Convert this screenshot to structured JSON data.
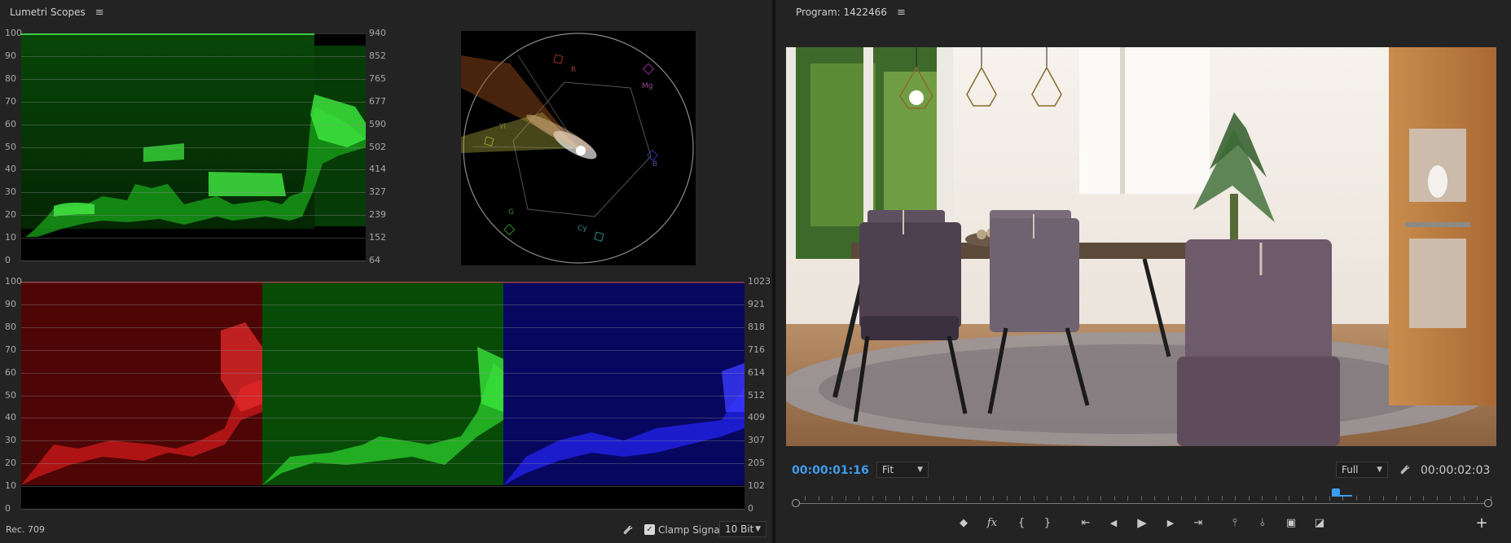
{
  "scopes": {
    "title": "Lumetri Scopes",
    "menu_icon": "hamburger-menu-icon",
    "luma_left_ticks": [
      "100",
      "90",
      "80",
      "70",
      "60",
      "50",
      "40",
      "30",
      "20",
      "10",
      "0"
    ],
    "luma_right_ticks": [
      "940",
      "852",
      "765",
      "677",
      "590",
      "502",
      "414",
      "327",
      "239",
      "152",
      "64"
    ],
    "rgb_left_ticks": [
      "100",
      "90",
      "80",
      "70",
      "60",
      "50",
      "40",
      "30",
      "20",
      "10",
      "0"
    ],
    "rgb_right_ticks": [
      "1023",
      "921",
      "818",
      "716",
      "614",
      "512",
      "409",
      "307",
      "205",
      "102",
      "0"
    ],
    "vectorscope_labels": {
      "r": "R",
      "mg": "Mg",
      "b": "B",
      "cy": "Cy",
      "g": "G",
      "yl": "Yl"
    },
    "footer": {
      "color_space": "Rec. 709",
      "clamp_label": "Clamp Signal",
      "clamp_checked": true,
      "bit_depth": "10 Bit"
    }
  },
  "program": {
    "title": "Program: 1422466",
    "menu_icon": "hamburger-menu-icon",
    "timecode_current": "00:00:01:16",
    "zoom": "Fit",
    "resolution": "Full",
    "timecode_duration": "00:00:02:03",
    "playhead_fraction": 0.78,
    "accent_color": "#3d9cf0"
  },
  "transport_icons": [
    "add-marker-icon",
    "fx-icon",
    "mark-in-icon",
    "mark-out-icon",
    "go-to-in-icon",
    "step-back-icon",
    "play-icon",
    "step-forward-icon",
    "go-to-out-icon",
    "lift-icon",
    "extract-icon",
    "export-frame-icon",
    "comparison-view-icon",
    "add-button-icon"
  ]
}
